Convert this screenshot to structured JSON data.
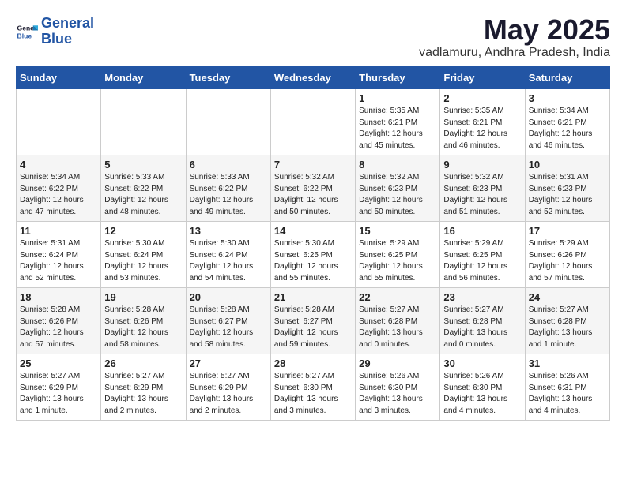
{
  "logo": {
    "line1": "General",
    "line2": "Blue"
  },
  "title": "May 2025",
  "location": "vadlamuru, Andhra Pradesh, India",
  "weekdays": [
    "Sunday",
    "Monday",
    "Tuesday",
    "Wednesday",
    "Thursday",
    "Friday",
    "Saturday"
  ],
  "weeks": [
    [
      {
        "day": "",
        "info": ""
      },
      {
        "day": "",
        "info": ""
      },
      {
        "day": "",
        "info": ""
      },
      {
        "day": "",
        "info": ""
      },
      {
        "day": "1",
        "info": "Sunrise: 5:35 AM\nSunset: 6:21 PM\nDaylight: 12 hours\nand 45 minutes."
      },
      {
        "day": "2",
        "info": "Sunrise: 5:35 AM\nSunset: 6:21 PM\nDaylight: 12 hours\nand 46 minutes."
      },
      {
        "day": "3",
        "info": "Sunrise: 5:34 AM\nSunset: 6:21 PM\nDaylight: 12 hours\nand 46 minutes."
      }
    ],
    [
      {
        "day": "4",
        "info": "Sunrise: 5:34 AM\nSunset: 6:22 PM\nDaylight: 12 hours\nand 47 minutes."
      },
      {
        "day": "5",
        "info": "Sunrise: 5:33 AM\nSunset: 6:22 PM\nDaylight: 12 hours\nand 48 minutes."
      },
      {
        "day": "6",
        "info": "Sunrise: 5:33 AM\nSunset: 6:22 PM\nDaylight: 12 hours\nand 49 minutes."
      },
      {
        "day": "7",
        "info": "Sunrise: 5:32 AM\nSunset: 6:22 PM\nDaylight: 12 hours\nand 50 minutes."
      },
      {
        "day": "8",
        "info": "Sunrise: 5:32 AM\nSunset: 6:23 PM\nDaylight: 12 hours\nand 50 minutes."
      },
      {
        "day": "9",
        "info": "Sunrise: 5:32 AM\nSunset: 6:23 PM\nDaylight: 12 hours\nand 51 minutes."
      },
      {
        "day": "10",
        "info": "Sunrise: 5:31 AM\nSunset: 6:23 PM\nDaylight: 12 hours\nand 52 minutes."
      }
    ],
    [
      {
        "day": "11",
        "info": "Sunrise: 5:31 AM\nSunset: 6:24 PM\nDaylight: 12 hours\nand 52 minutes."
      },
      {
        "day": "12",
        "info": "Sunrise: 5:30 AM\nSunset: 6:24 PM\nDaylight: 12 hours\nand 53 minutes."
      },
      {
        "day": "13",
        "info": "Sunrise: 5:30 AM\nSunset: 6:24 PM\nDaylight: 12 hours\nand 54 minutes."
      },
      {
        "day": "14",
        "info": "Sunrise: 5:30 AM\nSunset: 6:25 PM\nDaylight: 12 hours\nand 55 minutes."
      },
      {
        "day": "15",
        "info": "Sunrise: 5:29 AM\nSunset: 6:25 PM\nDaylight: 12 hours\nand 55 minutes."
      },
      {
        "day": "16",
        "info": "Sunrise: 5:29 AM\nSunset: 6:25 PM\nDaylight: 12 hours\nand 56 minutes."
      },
      {
        "day": "17",
        "info": "Sunrise: 5:29 AM\nSunset: 6:26 PM\nDaylight: 12 hours\nand 57 minutes."
      }
    ],
    [
      {
        "day": "18",
        "info": "Sunrise: 5:28 AM\nSunset: 6:26 PM\nDaylight: 12 hours\nand 57 minutes."
      },
      {
        "day": "19",
        "info": "Sunrise: 5:28 AM\nSunset: 6:26 PM\nDaylight: 12 hours\nand 58 minutes."
      },
      {
        "day": "20",
        "info": "Sunrise: 5:28 AM\nSunset: 6:27 PM\nDaylight: 12 hours\nand 58 minutes."
      },
      {
        "day": "21",
        "info": "Sunrise: 5:28 AM\nSunset: 6:27 PM\nDaylight: 12 hours\nand 59 minutes."
      },
      {
        "day": "22",
        "info": "Sunrise: 5:27 AM\nSunset: 6:28 PM\nDaylight: 13 hours\nand 0 minutes."
      },
      {
        "day": "23",
        "info": "Sunrise: 5:27 AM\nSunset: 6:28 PM\nDaylight: 13 hours\nand 0 minutes."
      },
      {
        "day": "24",
        "info": "Sunrise: 5:27 AM\nSunset: 6:28 PM\nDaylight: 13 hours\nand 1 minute."
      }
    ],
    [
      {
        "day": "25",
        "info": "Sunrise: 5:27 AM\nSunset: 6:29 PM\nDaylight: 13 hours\nand 1 minute."
      },
      {
        "day": "26",
        "info": "Sunrise: 5:27 AM\nSunset: 6:29 PM\nDaylight: 13 hours\nand 2 minutes."
      },
      {
        "day": "27",
        "info": "Sunrise: 5:27 AM\nSunset: 6:29 PM\nDaylight: 13 hours\nand 2 minutes."
      },
      {
        "day": "28",
        "info": "Sunrise: 5:27 AM\nSunset: 6:30 PM\nDaylight: 13 hours\nand 3 minutes."
      },
      {
        "day": "29",
        "info": "Sunrise: 5:26 AM\nSunset: 6:30 PM\nDaylight: 13 hours\nand 3 minutes."
      },
      {
        "day": "30",
        "info": "Sunrise: 5:26 AM\nSunset: 6:30 PM\nDaylight: 13 hours\nand 4 minutes."
      },
      {
        "day": "31",
        "info": "Sunrise: 5:26 AM\nSunset: 6:31 PM\nDaylight: 13 hours\nand 4 minutes."
      }
    ]
  ]
}
